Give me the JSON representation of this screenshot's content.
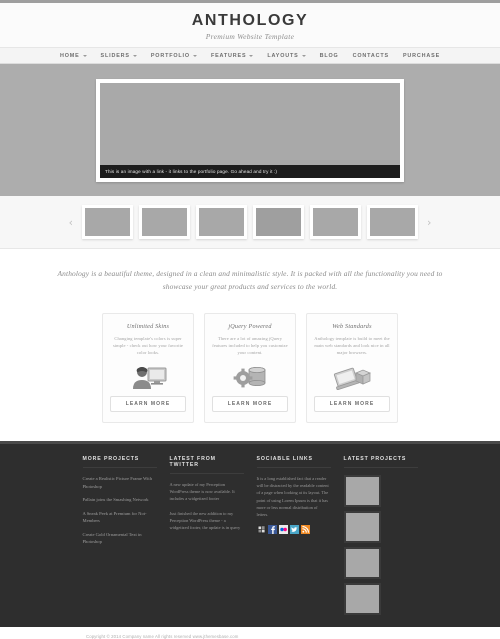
{
  "site": {
    "logo": "ANTHOLOGY",
    "tagline": "Premium Website Template"
  },
  "nav": {
    "items": [
      {
        "label": "HOME",
        "has_dropdown": true
      },
      {
        "label": "SLIDERS",
        "has_dropdown": true
      },
      {
        "label": "PORTFOLIO",
        "has_dropdown": true
      },
      {
        "label": "FEATURES",
        "has_dropdown": true
      },
      {
        "label": "LAYOUTS",
        "has_dropdown": true
      },
      {
        "label": "BLOG",
        "has_dropdown": false
      },
      {
        "label": "CONTACTS",
        "has_dropdown": false
      },
      {
        "label": "PURCHASE",
        "has_dropdown": false
      }
    ]
  },
  "slider": {
    "caption": "This is an image with a link - it links to the portfolio page. Go ahead and try it :)",
    "prev_icon": "chevron-left-icon",
    "next_icon": "chevron-right-icon",
    "thumbnails": [
      {
        "index": 1,
        "active": false
      },
      {
        "index": 2,
        "active": false
      },
      {
        "index": 3,
        "active": false
      },
      {
        "index": 4,
        "active": true
      },
      {
        "index": 5,
        "active": false
      },
      {
        "index": 6,
        "active": false
      }
    ]
  },
  "intro": {
    "text": "Anthology is a beautiful theme, designed in a clean and minimalistic style. It is packed with all the functionality you need to showcase your great products and services to the world."
  },
  "features": {
    "button_label": "LEARN MORE",
    "boxes": [
      {
        "title": "Unlimited Skins",
        "text": "Changing template's colors is super simple - check out how your favorite color looks.",
        "icon": "user-monitor-icon"
      },
      {
        "title": "jQuery Powered",
        "text": "There are a lot of amazing jQuery features included to help you customize your content.",
        "icon": "gear-database-icon"
      },
      {
        "title": "Web Standards",
        "text": "Anthology template is build to meet the main web standards and look nice in all major browsers.",
        "icon": "laptop-box-icon"
      }
    ]
  },
  "footer": {
    "columns": {
      "more_projects": {
        "title": "MORE PROJECTS",
        "links": [
          "Create a Realistic Picture Frame With Photoshop",
          "Pallain joins the Smashing Network",
          "A Sneak Peek at Premium for Not-Members",
          "Create Gold Ornamental Text in Photoshop"
        ]
      },
      "twitter": {
        "title": "LATEST FROM TWITTER",
        "tweets": [
          "A new update of my Perception WordPress theme is now available. It includes a widgetized footer",
          "Just finished the new addition to my Perception WordPress theme - a widgetized footer, the update is in query"
        ]
      },
      "sociable": {
        "title": "SOCIABLE LINKS",
        "text": "It is a long established fact that a reader will be distracted by the readable content of a page when looking at its layout. The point of using Lorem Ipsum is that it has more or less normal distribution of letters.",
        "icons": [
          {
            "name": "windows-icon",
            "color": "#2b2b2b"
          },
          {
            "name": "facebook-icon",
            "color": "#3b5998"
          },
          {
            "name": "flickr-icon",
            "color": "#e0e0e0"
          },
          {
            "name": "twitter-icon",
            "color": "#4aa6c7"
          },
          {
            "name": "rss-icon",
            "color": "#f08a24"
          }
        ]
      },
      "projects": {
        "title": "LATEST PROJECTS",
        "thumbs": [
          1,
          2,
          3,
          4
        ]
      }
    }
  },
  "copyright": {
    "text": "Copyright © 2014 Company name All rights reserved www.jthemesbase.com"
  }
}
